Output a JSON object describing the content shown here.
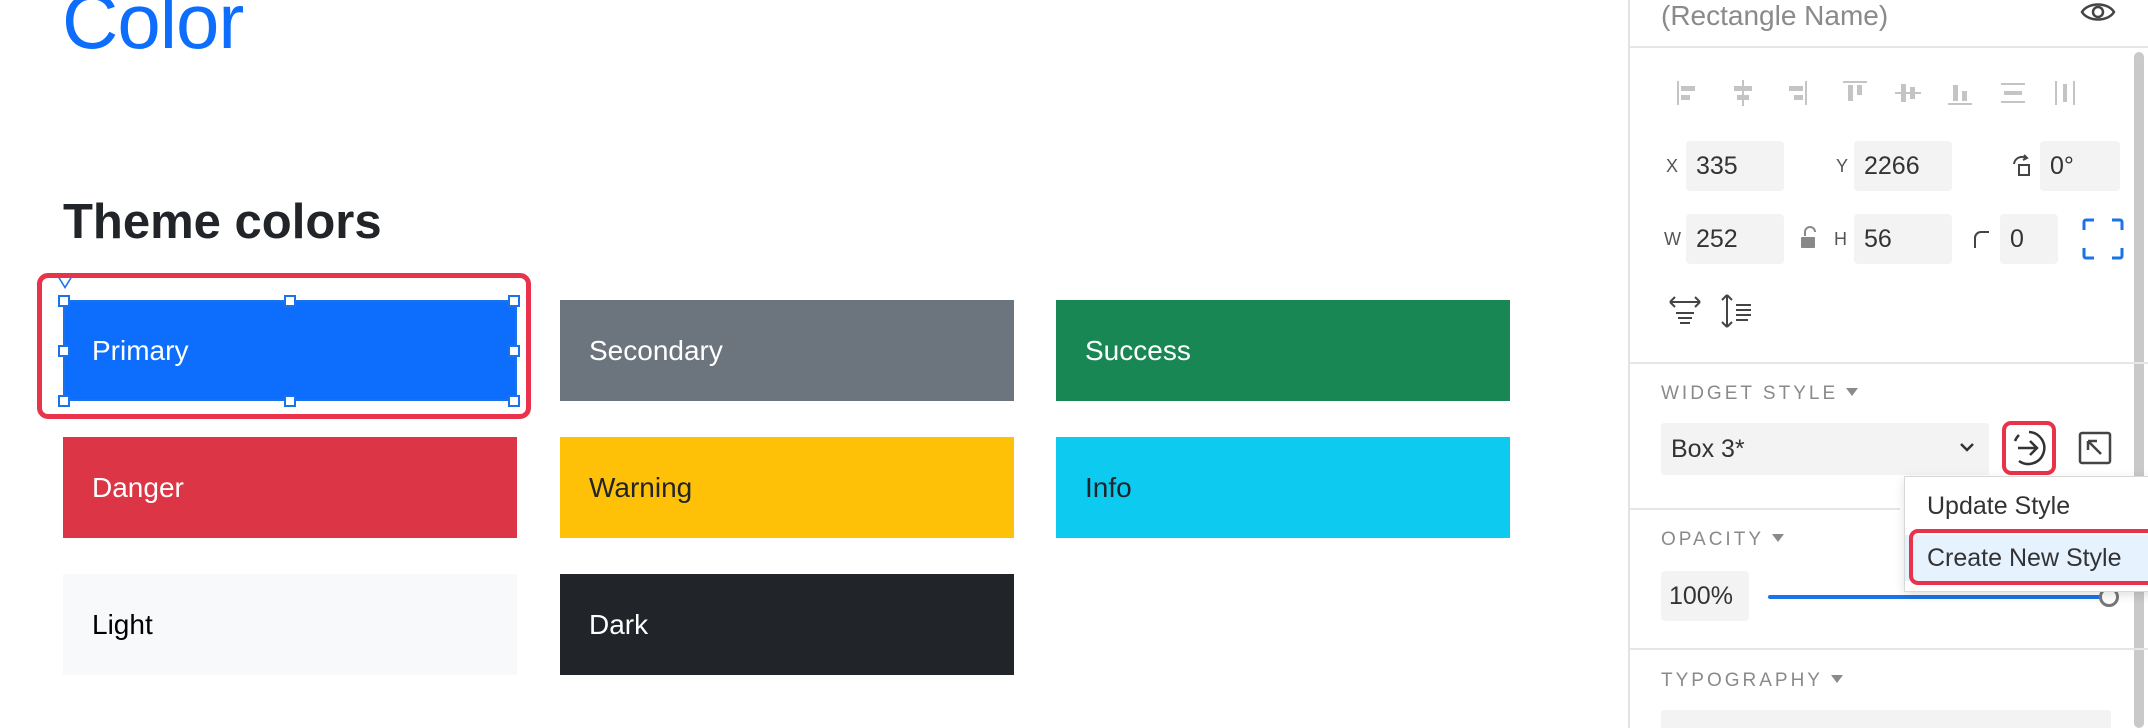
{
  "canvas": {
    "page_title": "Color",
    "section_title": "Theme colors",
    "swatches": [
      {
        "label": "Primary",
        "color": "#0d6efd"
      },
      {
        "label": "Secondary",
        "color": "#6c757d"
      },
      {
        "label": "Success",
        "color": "#198754"
      },
      {
        "label": "Danger",
        "color": "#dc3545"
      },
      {
        "label": "Warning",
        "color": "#ffc107"
      },
      {
        "label": "Info",
        "color": "#0dcaf0"
      },
      {
        "label": "Light",
        "color": "#f8f9fa"
      },
      {
        "label": "Dark",
        "color": "#212529"
      }
    ],
    "selected": "Primary",
    "highlight_color": "#e8334a"
  },
  "inspector": {
    "name_placeholder": "(Rectangle Name)",
    "visibility_icon": "eye-icon",
    "align_icons": [
      "align-left-icon",
      "align-center-h-icon",
      "align-right-icon",
      "align-top-icon",
      "align-middle-v-icon",
      "align-bottom-icon",
      "distribute-horizontal-icon",
      "distribute-vertical-icon"
    ],
    "x_label": "X",
    "x_value": "335",
    "y_label": "Y",
    "y_value": "2266",
    "rotation_value": "0°",
    "w_label": "W",
    "w_value": "252",
    "h_label": "H",
    "h_value": "56",
    "corner_radius_value": "0",
    "widget_style_label": "WIDGET STYLE",
    "widget_style_value": "Box 3*",
    "style_menu": {
      "items": [
        "Update Style",
        "Create New Style"
      ],
      "hovered": "Create New Style"
    },
    "opacity_label": "OPACITY",
    "opacity_value": "100%",
    "opacity_level": 1.0,
    "typography_label": "TYPOGRAPHY",
    "accent_color": "#1a73e8"
  }
}
